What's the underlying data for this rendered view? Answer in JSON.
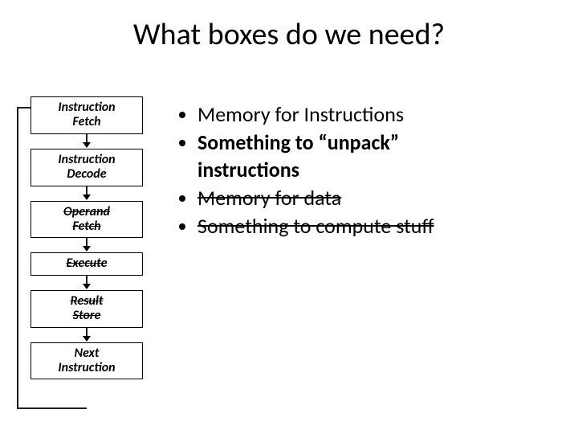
{
  "title": "What boxes do we need?",
  "stages": {
    "s1l1": "Instruction",
    "s1l2": "Fetch",
    "s2l1": "Instruction",
    "s2l2": "Decode",
    "s3l1": "Operand",
    "s3l2": "Fetch",
    "s4l1": "Execute",
    "s5l1": "Result",
    "s5l2": "Store",
    "s6l1": "Next",
    "s6l2": "Instruction"
  },
  "bullets": {
    "b1": "Memory for Instructions",
    "b2a": "Something to “unpack”",
    "b2b": "instructions",
    "b3": "Memory for data",
    "b4": "Something to compute stuff"
  }
}
